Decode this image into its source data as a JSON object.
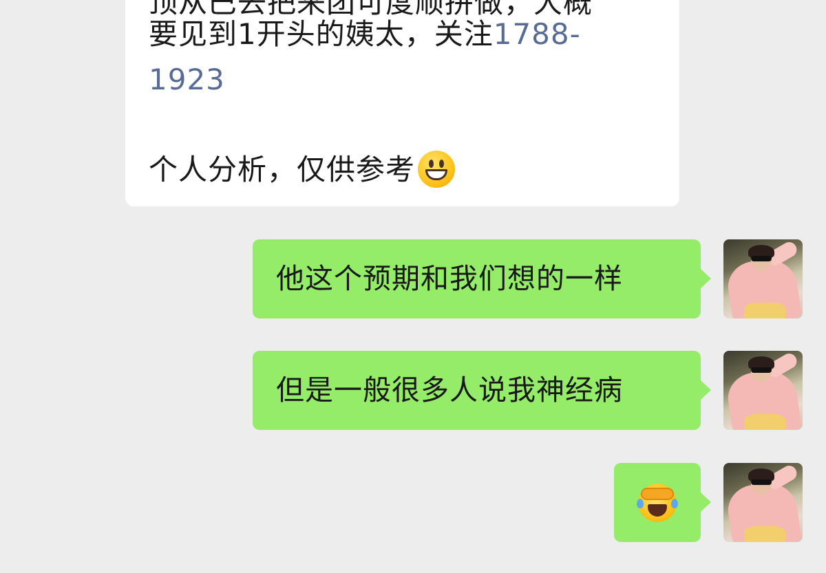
{
  "incoming_message": {
    "line0": "顶从巴去把来团可度顺拼做，大概",
    "line1_prefix": "要见到1开头的姨太，关注",
    "line1_link": "1788-",
    "line2_link": "1923",
    "line4_text": "个人分析，仅供参考",
    "line4_emoji": "grinning-face-emoji"
  },
  "outgoing_messages": [
    {
      "text": "他这个预期和我们想的一样"
    },
    {
      "text": "但是一般很多人说我神经病"
    },
    {
      "emoji": "rolling-on-the-floor-laughing-emoji"
    }
  ],
  "colors": {
    "background": "#ededed",
    "incoming_bubble": "#ffffff",
    "outgoing_bubble": "#95ec69",
    "link": "#576b95",
    "text": "#191919"
  }
}
